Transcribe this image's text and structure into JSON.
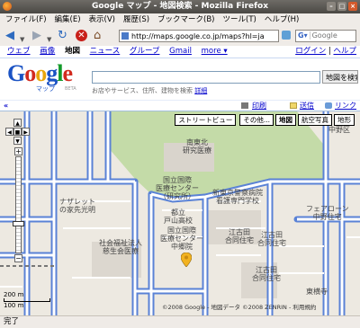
{
  "window": {
    "title": "Google マップ - 地図検索 - Mozilla Firefox"
  },
  "menubar": {
    "items": [
      "ファイル(F)",
      "編集(E)",
      "表示(V)",
      "履歴(S)",
      "ブックマーク(B)",
      "ツール(T)",
      "ヘルプ(H)"
    ]
  },
  "toolbar": {
    "url": "http://maps.google.co.jp/maps?hl=ja",
    "search_placeholder": "Google"
  },
  "gbar": {
    "links": [
      "ウェブ",
      "画像",
      "地図",
      "ニュース",
      "グループ",
      "Gmail",
      "more ▾"
    ],
    "selected": "地図",
    "login": "ログイン",
    "help": "ヘルプ"
  },
  "logo": {
    "text": "Google",
    "sub": "マップ",
    "beta": "BETA"
  },
  "search": {
    "button": "地図を検索",
    "hint": "お店やサービス、住所、建物を検索",
    "hint_link": "詳細"
  },
  "actions": {
    "print": "印刷",
    "send": "送信",
    "link": "リンク",
    "collapse": "«"
  },
  "map": {
    "types": [
      "ストリートビュー",
      "その他...",
      "地図",
      "航空写真",
      "地形"
    ],
    "selected_type": "地図",
    "scale": {
      "top": "200 m",
      "bottom": "100 m"
    },
    "copyright": "©2008 Google - 地図データ ©2008 ZENRIN - 利用規約",
    "labels": [
      "南東北\n研究医療",
      "国立国際\n医療センター\n（研究所）",
      "新東京警察病院\n看護専門学校",
      "国立国際\n医療センター\n中郷院",
      "ナザレット\nの家先光明",
      "都立\n戸山高校",
      "江古田\n合同住宅",
      "社会福祉法人\n慈生会医療",
      "江古田\n合同住宅",
      "フェアローン\n中野住宅",
      "江古田\n合同住宅",
      "東横寺",
      "中野区"
    ]
  },
  "status": {
    "text": "完了"
  }
}
